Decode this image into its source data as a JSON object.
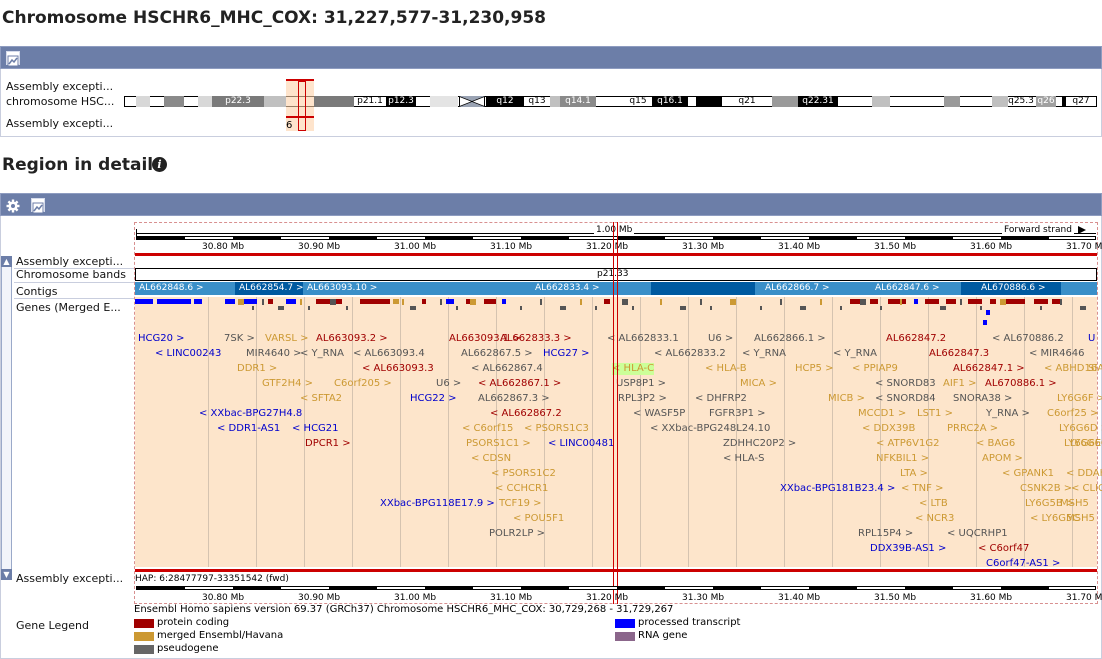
{
  "page_title": "Chromosome HSCHR6_MHC_COX: 31,227,577-31,230,958",
  "overview": {
    "labels": [
      "Assembly excepti...",
      "chromosome HSC...",
      "Assembly excepti..."
    ],
    "bands": [
      "p22.3",
      "p21.1",
      "p12.3",
      "q12",
      "q13",
      "q14.1",
      "q15",
      "q16.1",
      "q21",
      "q22.31",
      "q25.3",
      "q26",
      "q27"
    ],
    "marker": "6"
  },
  "region": {
    "heading": "Region in detail",
    "info_icon": "i",
    "tracks": [
      "Assembly excepti...",
      "Chromosome bands",
      "Contigs",
      "Genes (Merged E...",
      "Assembly excepti...",
      "Gene Legend"
    ],
    "scale_label": "1.00 Mb",
    "strand_label": "Forward strand",
    "ticks": [
      "30.80 Mb",
      "30.90 Mb",
      "31.00 Mb",
      "31.10 Mb",
      "31.20 Mb",
      "31.30 Mb",
      "31.40 Mb",
      "31.50 Mb",
      "31.60 Mb",
      "31.70 M"
    ],
    "band_label": "p21.33",
    "contigs": [
      "AL662848.6 >",
      "AL662854.7 >",
      "AL663093.10 >",
      "AL662833.4 >",
      "AL662866.7 >",
      "AL662847.6 >",
      "AL670886.6 >"
    ],
    "hap_label": "HAP: 6:28477797-33351542 (fwd)",
    "footer": "Ensembl Homo sapiens version 69.37 (GRCh37) Chromosome HSCHR6_MHC_COX: 30,729,268 - 31,729,267",
    "genes": [
      {
        "t": "HCG20 >",
        "c": "b"
      },
      {
        "t": "< LINC00243",
        "c": "b"
      },
      {
        "t": "7SK >",
        "c": "g"
      },
      {
        "t": "MIR4640 >",
        "c": "g"
      },
      {
        "t": "DDR1 >",
        "c": "o"
      },
      {
        "t": "GTF2H4 >",
        "c": "o"
      },
      {
        "t": "< SFTA2",
        "c": "o"
      },
      {
        "t": "< XXbac-BPG27H4.8",
        "c": "b"
      },
      {
        "t": "< DDR1-AS1",
        "c": "b"
      },
      {
        "t": "< HCG21",
        "c": "b"
      },
      {
        "t": "DPCR1 >",
        "c": "r"
      },
      {
        "t": "VARSL >",
        "c": "o"
      },
      {
        "t": "< Y_RNA",
        "c": "g"
      },
      {
        "t": "C6orf205 >",
        "c": "o"
      },
      {
        "t": "AL663093.2 >",
        "c": "r"
      },
      {
        "t": "< AL663093.4",
        "c": "g"
      },
      {
        "t": "< AL663093.3",
        "c": "r"
      },
      {
        "t": "U6 >",
        "c": "g"
      },
      {
        "t": "HCG22 >",
        "c": "b"
      },
      {
        "t": "AL663093.1 >",
        "c": "r"
      },
      {
        "t": "AL662867.5 >",
        "c": "g"
      },
      {
        "t": "< AL662867.4",
        "c": "g"
      },
      {
        "t": "< AL662867.1 >",
        "c": "r"
      },
      {
        "t": "AL662867.3 >",
        "c": "g"
      },
      {
        "t": "< AL662867.2",
        "c": "r"
      },
      {
        "t": "< C6orf15",
        "c": "o"
      },
      {
        "t": "PSORS1C1 >",
        "c": "o"
      },
      {
        "t": "< CDSN",
        "c": "o"
      },
      {
        "t": "< PSORS1C2",
        "c": "o"
      },
      {
        "t": "< CCHCR1",
        "c": "o"
      },
      {
        "t": "XXbac-BPG118E17.9 >",
        "c": "b"
      },
      {
        "t": "TCF19 >",
        "c": "o"
      },
      {
        "t": "< POU5F1",
        "c": "o"
      },
      {
        "t": "POLR2LP >",
        "c": "g"
      },
      {
        "t": "AL662833.3 >",
        "c": "r"
      },
      {
        "t": "HCG27 >",
        "c": "b"
      },
      {
        "t": "< PSORS1C3",
        "c": "o"
      },
      {
        "t": "< LINC00481",
        "c": "b"
      },
      {
        "t": "< AL662833.1",
        "c": "g"
      },
      {
        "t": "< AL662833.2",
        "c": "g"
      },
      {
        "t": "< HLA-C",
        "c": "o"
      },
      {
        "t": "USP8P1 >",
        "c": "g"
      },
      {
        "t": "RPL3P2 >",
        "c": "g"
      },
      {
        "t": "< WASF5P",
        "c": "g"
      },
      {
        "t": "< XXbac-BPG248L24.10",
        "c": "g"
      },
      {
        "t": "U6 >",
        "c": "g"
      },
      {
        "t": "< Y_RNA",
        "c": "g"
      },
      {
        "t": "< HLA-B",
        "c": "o"
      },
      {
        "t": "MICA >",
        "c": "o"
      },
      {
        "t": "< DHFRP2",
        "c": "g"
      },
      {
        "t": "FGFR3P1 >",
        "c": "g"
      },
      {
        "t": "ZDHHC20P2 >",
        "c": "g"
      },
      {
        "t": "< HLA-S",
        "c": "g"
      },
      {
        "t": "AL662866.1 >",
        "c": "g"
      },
      {
        "t": "HCP5 >",
        "c": "o"
      },
      {
        "t": "XXbac-BPG181B23.4 >",
        "c": "b"
      },
      {
        "t": "< Y_RNA",
        "c": "g"
      },
      {
        "t": "< PPIAP9",
        "c": "o"
      },
      {
        "t": "MICB >",
        "c": "o"
      },
      {
        "t": "MCCD1 >",
        "c": "o"
      },
      {
        "t": "< DDX39B",
        "c": "o"
      },
      {
        "t": "< ATP6V1G2",
        "c": "o"
      },
      {
        "t": "NFKBIL1 >",
        "c": "o"
      },
      {
        "t": "LTA >",
        "c": "o"
      },
      {
        "t": "< TNF >",
        "c": "o"
      },
      {
        "t": "< LTB",
        "c": "o"
      },
      {
        "t": "< NCR3",
        "c": "o"
      },
      {
        "t": "RPL15P4 >",
        "c": "g"
      },
      {
        "t": "DDX39B-AS1 >",
        "c": "b"
      },
      {
        "t": "< SNORD83",
        "c": "g"
      },
      {
        "t": "< SNORD84",
        "c": "g"
      },
      {
        "t": "LST1 >",
        "c": "o"
      },
      {
        "t": "AL662847.2",
        "c": "r"
      },
      {
        "t": "AL662847.3",
        "c": "r"
      },
      {
        "t": "AIF1 >",
        "c": "o"
      },
      {
        "t": "SNORA38 >",
        "c": "g"
      },
      {
        "t": "PRRC2A >",
        "c": "o"
      },
      {
        "t": "< BAG6",
        "c": "o"
      },
      {
        "t": "APOM >",
        "c": "o"
      },
      {
        "t": "< UQCRHP1",
        "c": "g"
      },
      {
        "t": "< C6orf47",
        "c": "r"
      },
      {
        "t": "C6orf47-AS1 >",
        "c": "b"
      },
      {
        "t": "AL662847.1 >",
        "c": "r"
      },
      {
        "t": "AL670886.1 >",
        "c": "r"
      },
      {
        "t": "< AL670886.2",
        "c": "g"
      },
      {
        "t": "< MIR4646",
        "c": "g"
      },
      {
        "t": "< ABHD16A",
        "c": "o"
      },
      {
        "t": "LY6G6F >",
        "c": "o"
      },
      {
        "t": "Y_RNA >",
        "c": "g"
      },
      {
        "t": "C6orf25 >",
        "c": "o"
      },
      {
        "t": "LY6G6D >",
        "c": "o"
      },
      {
        "t": "LY6G6E",
        "c": "o"
      },
      {
        "t": "< GPANK1",
        "c": "o"
      },
      {
        "t": "< DDAH",
        "c": "o"
      },
      {
        "t": "CSNK2B >",
        "c": "o"
      },
      {
        "t": "< CLIC1",
        "c": "o"
      },
      {
        "t": "LY6G5B >",
        "c": "o"
      },
      {
        "t": "MSH5",
        "c": "o"
      },
      {
        "t": "< LY6G5C",
        "c": "o"
      },
      {
        "t": "MSH5",
        "c": "o"
      },
      {
        "t": "LY6G6C",
        "c": "o"
      },
      {
        "t": "U",
        "c": "b"
      },
      {
        "t": "SP",
        "c": "o"
      }
    ]
  },
  "legend": {
    "items": [
      {
        "label": "protein coding",
        "color": "#a00000"
      },
      {
        "label": "processed transcript",
        "color": "#0000ff"
      },
      {
        "label": "merged Ensembl/Havana",
        "color": "#cc9933"
      },
      {
        "label": "RNA gene",
        "color": "#8b668b"
      },
      {
        "label": "pseudogene",
        "color": "#666666"
      }
    ]
  },
  "colors": {
    "header_bar": "#6c7ea8",
    "region_bg": "#fde5cb",
    "contig": "#3a8fc8",
    "contig_dark": "#005aa0",
    "highlight": "#cc0000"
  }
}
